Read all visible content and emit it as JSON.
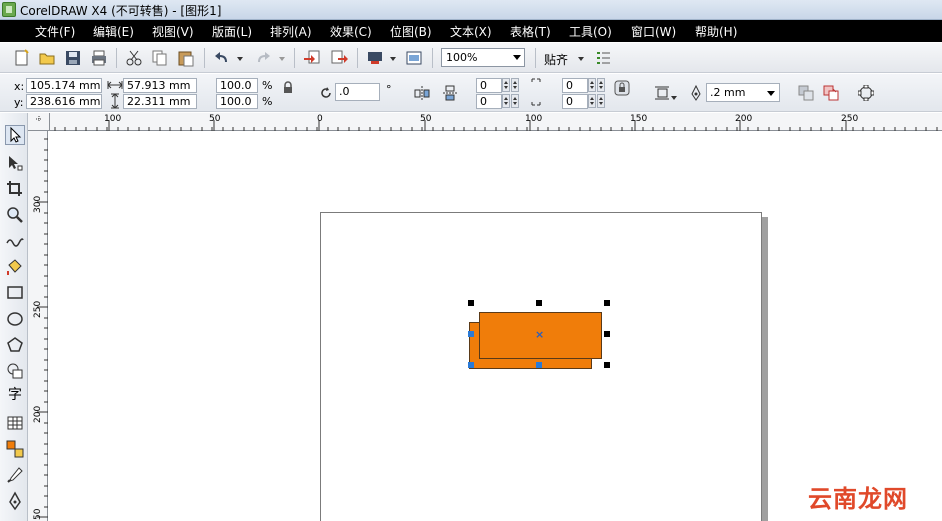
{
  "window": {
    "title": "CorelDRAW X4 (不可转售) - [图形1]"
  },
  "menu": [
    {
      "id": "file",
      "label": "文件(F)"
    },
    {
      "id": "edit",
      "label": "编辑(E)"
    },
    {
      "id": "view",
      "label": "视图(V)"
    },
    {
      "id": "layout",
      "label": "版面(L)"
    },
    {
      "id": "arrange",
      "label": "排列(A)"
    },
    {
      "id": "effects",
      "label": "效果(C)"
    },
    {
      "id": "bitmaps",
      "label": "位图(B)"
    },
    {
      "id": "text",
      "label": "文本(X)"
    },
    {
      "id": "table",
      "label": "表格(T)"
    },
    {
      "id": "tools",
      "label": "工具(O)"
    },
    {
      "id": "window",
      "label": "窗口(W)"
    },
    {
      "id": "help",
      "label": "帮助(H)"
    }
  ],
  "toolbar": {
    "zoom": "100%",
    "snap_label": "贴齐"
  },
  "propbar": {
    "x_label": "x:",
    "y_label": "y:",
    "x_value": "105.174 mm",
    "y_value": "238.616 mm",
    "width_value": "57.913 mm",
    "height_value": "22.311 mm",
    "scale_x": "100.0",
    "scale_y": "100.0",
    "percent": "%",
    "rotation": ".0",
    "degree": "°",
    "corner_tl": "0",
    "corner_bl": "0",
    "corner_tr": "0",
    "corner_br": "0",
    "outline_width": ".2 mm"
  },
  "ruler": {
    "h_ticks": [
      "100",
      "50",
      "0",
      "50",
      "100",
      "150",
      "200",
      "250"
    ],
    "v_ticks": [
      "300",
      "250",
      "200",
      "50"
    ]
  },
  "shapes": {
    "fill_color": "#f07d0a",
    "handle_color": "#000000",
    "selected_handle_color": "#2a7ad6"
  },
  "watermark": "云南龙网"
}
